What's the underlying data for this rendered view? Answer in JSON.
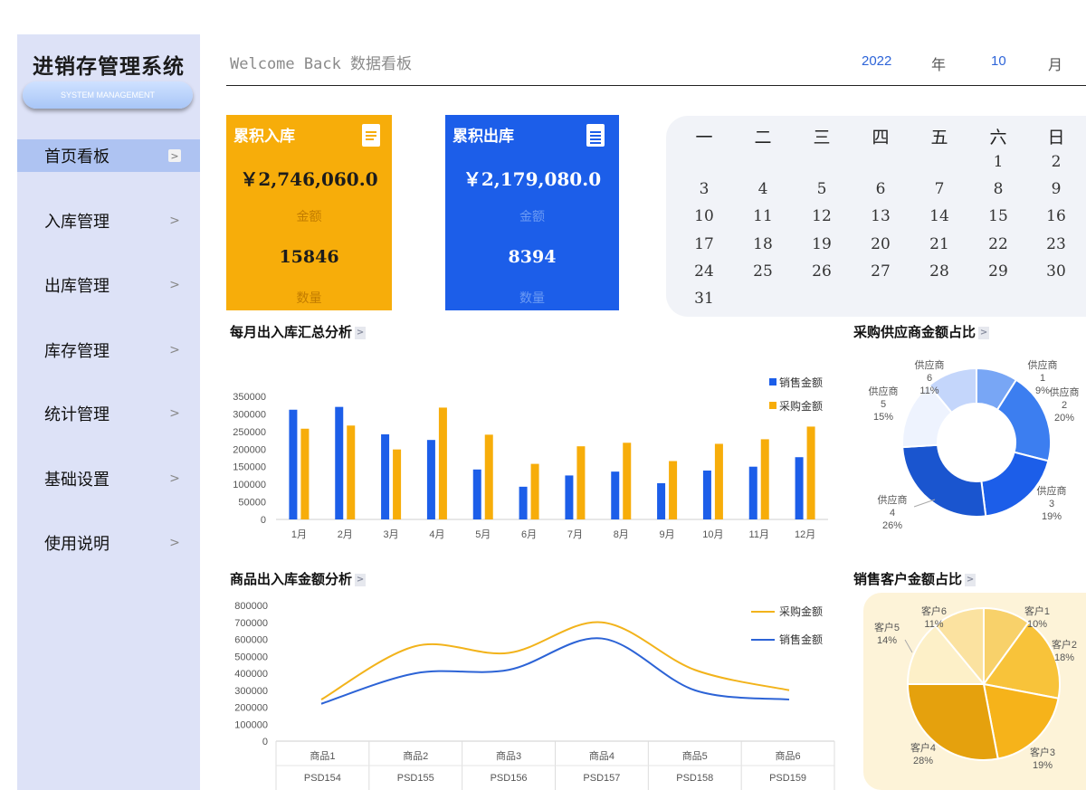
{
  "app": {
    "title": "进销存管理系统",
    "subtitle": "SYSTEM MANAGEMENT"
  },
  "nav": [
    {
      "label": "首页看板",
      "active": true
    },
    {
      "label": "入库管理"
    },
    {
      "label": "出库管理"
    },
    {
      "label": "库存管理"
    },
    {
      "label": "统计管理"
    },
    {
      "label": "基础设置"
    },
    {
      "label": "使用说明"
    }
  ],
  "header": {
    "welcome": "Welcome Back 数据看板",
    "year": "2022",
    "year_unit": "年",
    "month": "10",
    "month_unit": "月"
  },
  "cards": {
    "in": {
      "title": "累积入库",
      "amount": "￥2,746,060.0",
      "amount_label": "金额",
      "quantity": "15846",
      "quantity_label": "数量",
      "color": "#f7ad0a"
    },
    "out": {
      "title": "累积出库",
      "amount": "￥2,179,080.0",
      "amount_label": "金额",
      "quantity": "8394",
      "quantity_label": "数量",
      "color": "#1c5ee9"
    }
  },
  "calendar": {
    "weekdays": [
      "一",
      "二",
      "三",
      "四",
      "五",
      "六",
      "日"
    ],
    "weeks": [
      [
        "",
        "",
        "",
        "",
        "",
        "1",
        "2"
      ],
      [
        "3",
        "4",
        "5",
        "6",
        "7",
        "8",
        "9"
      ],
      [
        "10",
        "11",
        "12",
        "13",
        "14",
        "15",
        "16"
      ],
      [
        "17",
        "18",
        "19",
        "20",
        "21",
        "22",
        "23"
      ],
      [
        "24",
        "25",
        "26",
        "27",
        "28",
        "29",
        "30"
      ],
      [
        "31",
        "",
        "",
        "",
        "",
        "",
        ""
      ]
    ]
  },
  "sections": {
    "monthly": "每月出入库汇总分析",
    "supplier": "采购供应商金额占比",
    "product": "商品出入库金额分析",
    "customer": "销售客户金额占比"
  },
  "chart_data": [
    {
      "type": "bar",
      "title": "每月出入库汇总分析",
      "categories": [
        "1月",
        "2月",
        "3月",
        "4月",
        "5月",
        "6月",
        "7月",
        "8月",
        "9月",
        "10月",
        "11月",
        "12月"
      ],
      "series": [
        {
          "name": "销售金额",
          "color": "#1c5ee9",
          "values": [
            312000,
            320000,
            242000,
            226000,
            142000,
            93000,
            125000,
            136000,
            103000,
            139000,
            150000,
            177000
          ]
        },
        {
          "name": "采购金额",
          "color": "#f7ad0a",
          "values": [
            258000,
            267000,
            199000,
            318000,
            241000,
            158000,
            208000,
            218000,
            166000,
            215000,
            228000,
            264000
          ]
        }
      ],
      "yticks": [
        "0",
        "50000",
        "100000",
        "150000",
        "200000",
        "250000",
        "300000",
        "350000"
      ],
      "ylim": [
        0,
        350000
      ],
      "legend": "top-right"
    },
    {
      "type": "pie",
      "title": "采购供应商金额占比",
      "donut": true,
      "slices": [
        {
          "label": "供应商1",
          "value": 9,
          "pct": "9%",
          "color": "#78a6f5"
        },
        {
          "label": "供应商2",
          "value": 20,
          "pct": "20%",
          "color": "#3c7ef0"
        },
        {
          "label": "供应商3",
          "value": 19,
          "pct": "19%",
          "color": "#1c5ee9"
        },
        {
          "label": "供应商4",
          "value": 26,
          "pct": "26%",
          "color": "#1a55cf"
        },
        {
          "label": "供应商5",
          "value": 15,
          "pct": "15%",
          "color": "#eef3fe"
        },
        {
          "label": "供应商6",
          "value": 11,
          "pct": "11%",
          "color": "#c4d6fb"
        }
      ]
    },
    {
      "type": "line",
      "title": "商品出入库金额分析",
      "categories": [
        {
          "name": "商品1",
          "code": "PSD154"
        },
        {
          "name": "商品2",
          "code": "PSD155"
        },
        {
          "name": "商品3",
          "code": "PSD156"
        },
        {
          "name": "商品4",
          "code": "PSD157"
        },
        {
          "name": "商品5",
          "code": "PSD158"
        },
        {
          "name": "商品6",
          "code": "PSD159"
        }
      ],
      "series": [
        {
          "name": "采购金额",
          "color": "#f2b31b",
          "values": [
            245000,
            560000,
            520000,
            700000,
            420000,
            300000
          ]
        },
        {
          "name": "销售金额",
          "color": "#2c63d6",
          "values": [
            220000,
            400000,
            420000,
            605000,
            300000,
            245000
          ]
        }
      ],
      "yticks": [
        "0",
        "100000",
        "200000",
        "300000",
        "400000",
        "500000",
        "600000",
        "700000",
        "800000"
      ],
      "ylim": [
        0,
        800000
      ],
      "legend": "top-right"
    },
    {
      "type": "pie",
      "title": "销售客户金额占比",
      "slices": [
        {
          "label": "客户1",
          "value": 10,
          "pct": "10%",
          "color": "#f8d16a"
        },
        {
          "label": "客户2",
          "value": 18,
          "pct": "18%",
          "color": "#f8c33a"
        },
        {
          "label": "客户3",
          "value": 19,
          "pct": "19%",
          "color": "#f6b31a"
        },
        {
          "label": "客户4",
          "value": 28,
          "pct": "28%",
          "color": "#e5a10d"
        },
        {
          "label": "客户5",
          "value": 14,
          "pct": "14%",
          "color": "#fdf0c8"
        },
        {
          "label": "客户6",
          "value": 11,
          "pct": "11%",
          "color": "#fbe2a0"
        }
      ]
    }
  ]
}
